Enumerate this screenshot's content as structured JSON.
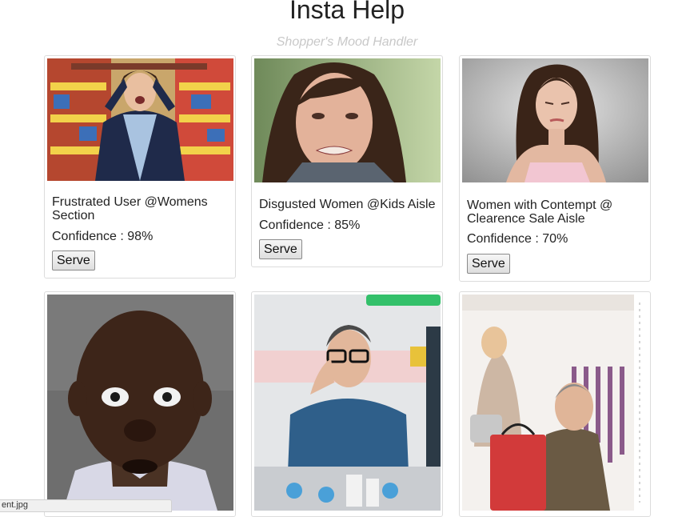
{
  "header": {
    "title": "Insta Help",
    "subtitle": "Shopper's Mood Handler"
  },
  "cards": [
    {
      "caption": "Frustrated User @Womens Section",
      "confidence": "Confidence : 98%",
      "button": "Serve"
    },
    {
      "caption": "Disgusted Women @Kids Aisle",
      "confidence": "Confidence : 85%",
      "button": "Serve"
    },
    {
      "caption": "Women with Contempt @ Clearence Sale Aisle",
      "confidence": "Confidence : 70%",
      "button": "Serve"
    },
    {
      "caption": "",
      "confidence": "",
      "button": ""
    },
    {
      "caption": "",
      "confidence": "",
      "button": ""
    },
    {
      "caption": "",
      "confidence": "",
      "button": ""
    }
  ],
  "status_bar": {
    "text": "ent.jpg"
  },
  "colors": {
    "title": "#222222",
    "subtitle": "#c8c8c8",
    "card_border": "#dcdcdc"
  }
}
